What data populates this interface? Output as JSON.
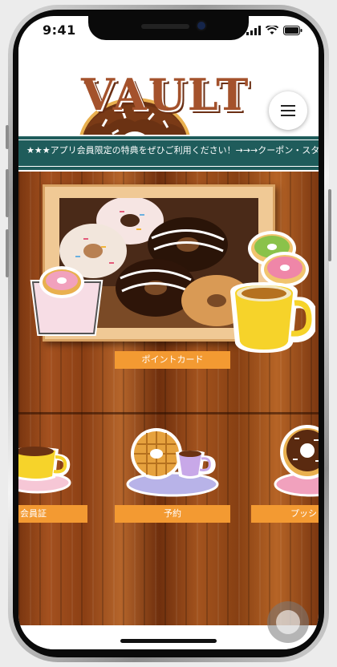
{
  "status_bar": {
    "time": "9:41"
  },
  "app": {
    "logo_text": "VAULT"
  },
  "ticker": {
    "text": "★★★アプリ会員限定の特典をぜひご利用ください！→→→クーポン・スタンプ"
  },
  "main": {
    "point_card_label": "ポイントカード"
  },
  "menu": {
    "items": [
      {
        "label": "会員証"
      },
      {
        "label": "予約"
      },
      {
        "label": "プッシ"
      }
    ]
  },
  "icons": [
    "signal-icon",
    "wifi-icon",
    "battery-icon",
    "hamburger-menu-icon"
  ],
  "colors": {
    "accent_orange": "#f39a32",
    "ticker_teal": "#1f5c5b",
    "wood": "#a4511f"
  }
}
